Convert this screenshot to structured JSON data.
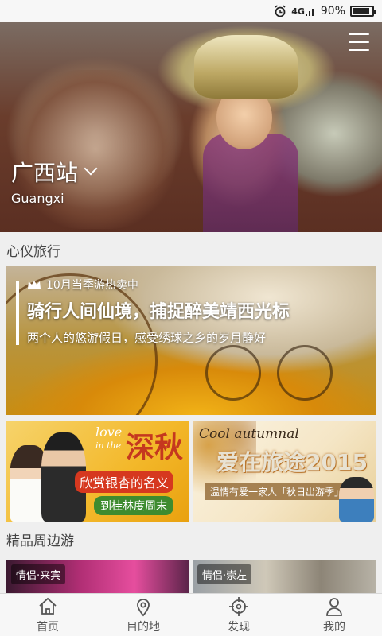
{
  "status": {
    "network": "4G",
    "battery_text": "90%",
    "battery_level": 0.9
  },
  "hero": {
    "title": "广西站",
    "subtitle": "Guangxi"
  },
  "section1": {
    "title": "心仪旅行"
  },
  "feature": {
    "tag": "10月当季游热卖中",
    "title": "骑行人间仙境，捕捉醉美靖西光标",
    "description": "两个人的悠游假日，感受绣球之乡的岁月静好"
  },
  "promo_left": {
    "script": "love",
    "script2": "in the",
    "big": "深秋",
    "line1": "欣赏银杏的名义",
    "line2": "到桂林度周末"
  },
  "promo_right": {
    "script": "Cool autumnal",
    "big": "爱在旅途2015",
    "line1": "温情有爱一家人「秋日出游季」"
  },
  "section2": {
    "title": "精品周边游"
  },
  "cards": [
    {
      "badge": "情侣·来宾"
    },
    {
      "badge": "情侣·崇左"
    }
  ],
  "tabs": [
    {
      "label": "首页",
      "icon": "home-icon"
    },
    {
      "label": "目的地",
      "icon": "location-pin-icon"
    },
    {
      "label": "发现",
      "icon": "crosshair-icon"
    },
    {
      "label": "我的",
      "icon": "person-icon"
    }
  ]
}
